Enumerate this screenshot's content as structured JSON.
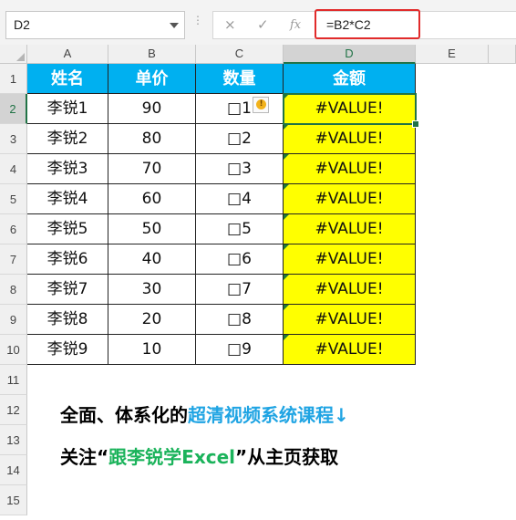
{
  "formula_bar": {
    "name_box": "D2",
    "cancel_icon": "×",
    "enter_icon": "✓",
    "fx_icon": "fx",
    "formula": "=B2*C2"
  },
  "columns": [
    "A",
    "B",
    "C",
    "D",
    "E"
  ],
  "selected_column": "D",
  "selected_row": "2",
  "row_numbers": [
    "1",
    "2",
    "3",
    "4",
    "5",
    "6",
    "7",
    "8",
    "9",
    "10",
    "11",
    "12",
    "13",
    "14",
    "15"
  ],
  "table": {
    "headers": [
      "姓名",
      "单价",
      "数量",
      "金额"
    ],
    "rows": [
      [
        "李锐1",
        "90",
        "□1",
        "#VALUE!"
      ],
      [
        "李锐2",
        "80",
        "□2",
        "#VALUE!"
      ],
      [
        "李锐3",
        "70",
        "□3",
        "#VALUE!"
      ],
      [
        "李锐4",
        "60",
        "□4",
        "#VALUE!"
      ],
      [
        "李锐5",
        "50",
        "□5",
        "#VALUE!"
      ],
      [
        "李锐6",
        "40",
        "□6",
        "#VALUE!"
      ],
      [
        "李锐7",
        "30",
        "□7",
        "#VALUE!"
      ],
      [
        "李锐8",
        "20",
        "□8",
        "#VALUE!"
      ],
      [
        "李锐9",
        "10",
        "□9",
        "#VALUE!"
      ]
    ]
  },
  "error_indicator_icon": "!",
  "promo": {
    "line1_a": "全面、体系化的",
    "line1_b": "超清视频系统课程↓",
    "line2_a": "关注“",
    "line2_b": "跟李锐学Excel",
    "line2_c": "”从主页获取"
  },
  "colors": {
    "header_fill": "#00b0f0",
    "result_fill": "#ffff00",
    "formula_outline": "#e12b2b",
    "selection": "#217346",
    "promo_blue": "#1fa4e3",
    "promo_green": "#1bb35b"
  }
}
